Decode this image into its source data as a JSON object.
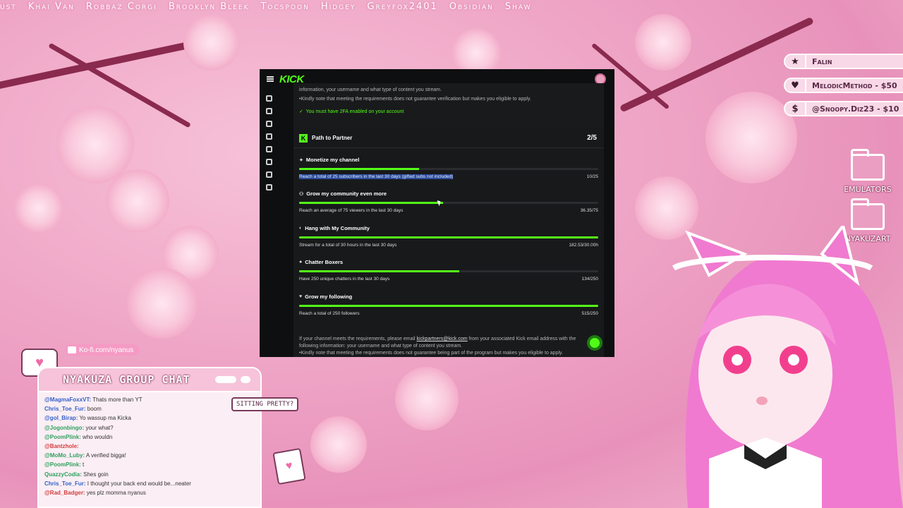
{
  "ticker": [
    "ust",
    "Khai Van",
    "Robbaz Corgi",
    "Brooklyn Bleek",
    "Tocspoon",
    "Hidgey",
    "Greyfox2401",
    "Obsidian",
    "Shaw"
  ],
  "alerts": [
    {
      "icon": "star-icon",
      "glyph": "★",
      "text": "Falin"
    },
    {
      "icon": "heart-icon",
      "glyph": "♥",
      "text": "MelodicMethod - $50"
    },
    {
      "icon": "dollar-icon",
      "glyph": "$",
      "text": "@Snoopy.Diz23 - $10"
    }
  ],
  "folders": [
    "EMULATORS",
    "NYAKUZART"
  ],
  "browser": {
    "intro_line": "information, your username and what type of content you stream.",
    "note_line": "•Kindly note that meeting the requirements does not guarantee verification but makes you eligible to apply.",
    "requirement": "You must have 2FA enabled on your account",
    "card": {
      "title": "Path to Partner",
      "count": "2/5",
      "tasks": [
        {
          "title": "Monetize my channel",
          "detail": "Reach a total of 25 subscribers in the last 30 days (gifted subs not included)",
          "value": "10/25",
          "progress": 0.4
        },
        {
          "title": "Grow my community even more",
          "detail": "Reach an average of 75 viewers in the last 30 days",
          "value": "36.35/75",
          "progress": 0.48
        },
        {
          "title": "Hang with My Community",
          "detail": "Stream for a total of 30 hours in the last 30 days",
          "value": "182.53/30.00h",
          "progress": 1.0
        },
        {
          "title": "Chatter Boxers",
          "detail": "Have 250 unique chatters in the last 30 days",
          "value": "134/250",
          "progress": 0.536
        },
        {
          "title": "Grow my following",
          "detail": "Reach a total of 250 followers",
          "value": "515/250",
          "progress": 1.0
        }
      ]
    },
    "footer_line1_pre": "If your channel meets the requirements, please email ",
    "footer_email": "kickpartners@kick.com",
    "footer_line1_post": " from your associated Kick email address with the",
    "footer_line2": "following information: your username and what type of content you stream.",
    "footer_line3": "•Kindly note that meeting the requirements does not guarantee being part of the program but makes you eligible to apply."
  },
  "kofi": "Ko-fi.com/nyanus",
  "chat": {
    "title": "NYAKUZA GROUP CHAT",
    "messages": [
      {
        "user": "@MagmaFoxxVT:",
        "text": " Thats more than YT",
        "ucls": "u"
      },
      {
        "user": "Chris_Toe_Fur:",
        "text": " boom",
        "ucls": "u"
      },
      {
        "user": "@gol_Birap:",
        "text": " Yo wassup ma Kicka",
        "ucls": "u"
      },
      {
        "user": "@Jogonbingo:",
        "text": " your what?",
        "ucls": "g"
      },
      {
        "user": "@PoomPlink:",
        "text": " who wouldn",
        "ucls": "g"
      },
      {
        "user": "@Bantzhole:",
        "text": "",
        "ucls": "r"
      },
      {
        "user": "@MoMo_Luby:",
        "text": " A verified bigga!",
        "ucls": "g"
      },
      {
        "user": "@PoomPlink:",
        "text": " t",
        "ucls": "g"
      },
      {
        "user": "QuazzyCodia:",
        "text": " Shes goin",
        "ucls": "g"
      },
      {
        "user": "Chris_Toe_Fur:",
        "text": " I thought your back end would be...neater",
        "ucls": "u"
      },
      {
        "user": "@Rad_Badger:",
        "text": " yes plz momma nyanus",
        "ucls": "r"
      }
    ]
  },
  "sitting_pretty": "SITTING PRETTY?",
  "colors": {
    "kick_green": "#53fc18",
    "panel_bg": "#191a1c",
    "pink_bg": "#efa6c6"
  }
}
